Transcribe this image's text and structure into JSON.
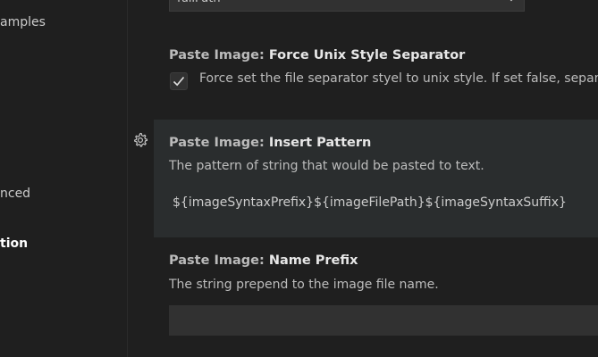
{
  "toc": {
    "items": [
      {
        "label": "amples"
      },
      {
        "label": "nced"
      },
      {
        "label": "tion"
      }
    ]
  },
  "path_dropdown": {
    "value": "fullPath"
  },
  "settings": {
    "force_unix": {
      "category": "Paste Image: ",
      "name": "Force Unix Style Separator",
      "checkbox_label": "Force set the file separator styel to unix style. If set false, separ",
      "checked": true
    },
    "insert_pattern": {
      "category": "Paste Image: ",
      "name": "Insert Pattern",
      "description": "The pattern of string that would be pasted to text.",
      "value": "${imageSyntaxPrefix}${imageFilePath}${imageSyntaxSuffix}"
    },
    "name_prefix": {
      "category": "Paste Image: ",
      "name": "Name Prefix",
      "description": "The string prepend to the image file name.",
      "value": ""
    }
  },
  "icons": {
    "gear": "gear-icon",
    "check": "check-icon",
    "chevron": "chevron-down-icon"
  }
}
